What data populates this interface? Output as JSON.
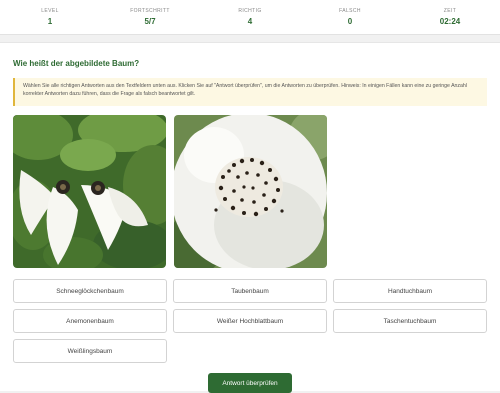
{
  "stats": [
    {
      "label": "LEVEL",
      "value": "1"
    },
    {
      "label": "FORTSCHRITT",
      "value": "5/7"
    },
    {
      "label": "RICHTIG",
      "value": "4"
    },
    {
      "label": "FALSCH",
      "value": "0"
    },
    {
      "label": "ZEIT",
      "value": "02:24"
    }
  ],
  "question": "Wie heißt der abgebildete Baum?",
  "hint": "Wählen Sie alle richtigen Antworten aus den Textfeldern unten aus. Klicken Sie auf \"Antwort überprüfen\", um die Antworten zu überprüfen. Hinweis: In einigen Fällen kann eine zu geringe Anzahl korrekter Antworten dazu führen, dass die Frage als falsch beantwortet gilt.",
  "options": [
    "Schneeglöckchenbaum",
    "Taubenbaum",
    "Handtuchbaum",
    "Anemonenbaum",
    "Weißer Hochblattbaum",
    "Taschentuchbaum",
    "Weißlingsbaum"
  ],
  "submit_label": "Antwort überprüfen",
  "colors": {
    "accent": "#2e6b33",
    "hint_bg": "#fdf8e3",
    "hint_border": "#e0b63c"
  }
}
